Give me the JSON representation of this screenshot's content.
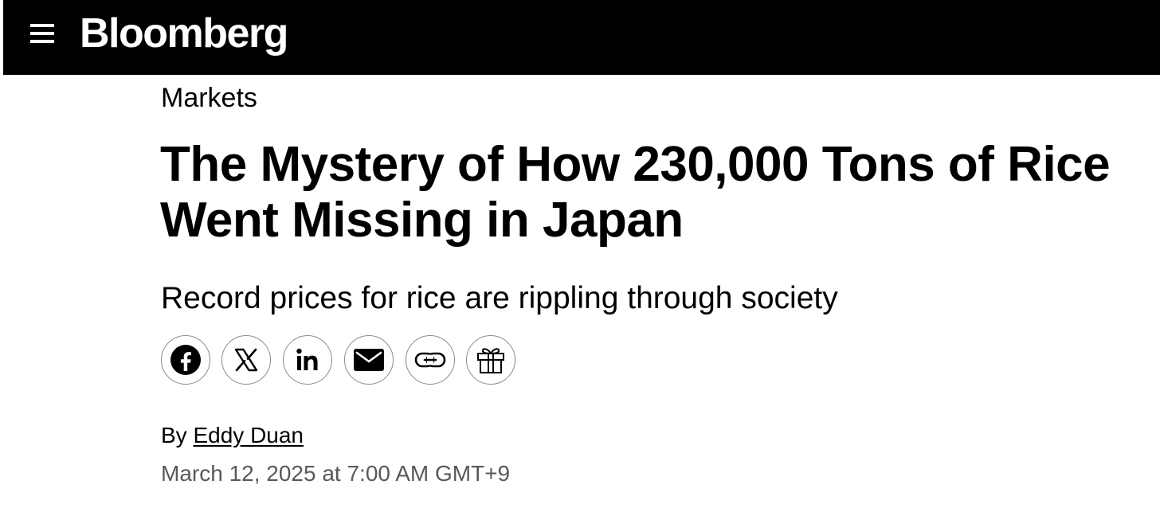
{
  "header": {
    "logo_text": "Bloomberg",
    "menu_icon": "hamburger-menu-icon",
    "background_color": "#000000",
    "text_color": "#ffffff"
  },
  "article": {
    "section": "Markets",
    "headline": "The Mystery of How 230,000 Tons of Rice Went Missing in Japan",
    "dek": "Record prices for rice are rippling through society",
    "byline_prefix": "By",
    "author": "Eddy Duan",
    "published": "March 12, 2025 at 7:00 AM GMT+9",
    "date_color": "#595959"
  },
  "share": {
    "buttons": [
      {
        "id": "facebook",
        "icon": "facebook-icon"
      },
      {
        "id": "x",
        "icon": "x-twitter-icon"
      },
      {
        "id": "linkedin",
        "icon": "linkedin-icon"
      },
      {
        "id": "email",
        "icon": "email-icon"
      },
      {
        "id": "copy-link",
        "icon": "link-icon"
      },
      {
        "id": "gift",
        "icon": "gift-icon"
      }
    ]
  }
}
